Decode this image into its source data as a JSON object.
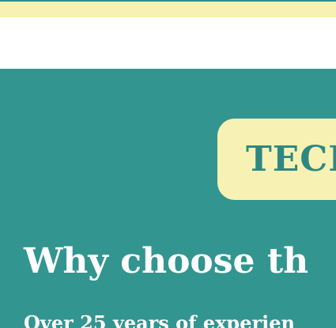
{
  "hero": {
    "badge": "TECH",
    "headline": "Why choose th",
    "subline": "Over 25 years of experien"
  },
  "colors": {
    "teal": "#339590",
    "cream": "#f7f2b4",
    "badge_text": "#2f8781",
    "white": "#ffffff"
  }
}
